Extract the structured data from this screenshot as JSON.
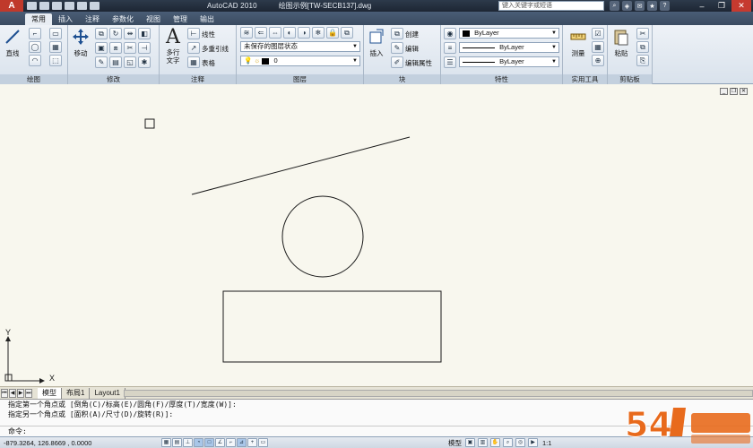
{
  "app": {
    "logo": "A",
    "title": "AutoCAD 2010",
    "file_name": "绘图示例[TW-SECB137].dwg",
    "search_placeholder": "键入关键字或短语"
  },
  "ribbon": {
    "tabs": [
      "常用",
      "插入",
      "注释",
      "参数化",
      "视图",
      "管理",
      "输出"
    ],
    "active_tab": "常用",
    "panels": {
      "draw": {
        "title": "绘图",
        "line_label": "直线"
      },
      "modify": {
        "title": "修改",
        "move_label": "移动"
      },
      "annotation": {
        "title": "注释",
        "mtext_label": "多行\n文字",
        "linear_label": "线性",
        "mleader_label": "多重引线",
        "table_label": "表格"
      },
      "layers": {
        "title": "图层",
        "layer_state": "未保存的图层状态",
        "current_layer": "0"
      },
      "block": {
        "title": "块",
        "insert_label": "插入",
        "create_label": "创建",
        "edit_label": "编辑",
        "edit_attr_label": "编辑属性"
      },
      "properties": {
        "title": "特性",
        "color": "ByLayer",
        "linetype": "ByLayer",
        "lineweight": "ByLayer"
      },
      "utilities": {
        "title": "实用工具",
        "measure_label": "测量"
      },
      "clipboard": {
        "title": "剪贴板",
        "paste_label": "粘贴"
      }
    }
  },
  "canvas": {
    "ucs_x": "X",
    "ucs_y": "Y",
    "line_color": "#1a1a1a",
    "background": "#f8f7ee"
  },
  "layout_tabs": [
    "模型",
    "布局1",
    "Layout1"
  ],
  "command_line": {
    "history": [
      "指定第一个角点或 [倒角(C)/标高(E)/圆角(F)/厚度(T)/宽度(W)]:",
      "指定另一个角点或 [面积(A)/尺寸(D)/旋转(R)]:"
    ],
    "prompt": "命令:"
  },
  "status": {
    "coordinates": "-879.3264, 126.8669 , 0.0000",
    "model_label": "模型",
    "scale": "1:1"
  },
  "watermark": {
    "text": "54"
  }
}
